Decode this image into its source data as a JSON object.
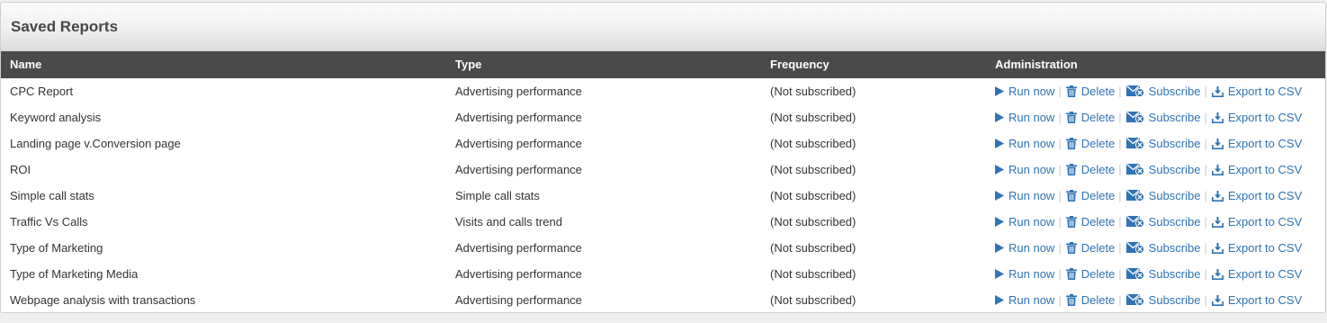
{
  "panel": {
    "title": "Saved Reports"
  },
  "table": {
    "columns": [
      "Name",
      "Type",
      "Frequency",
      "Administration"
    ],
    "rows": [
      {
        "name": "CPC Report",
        "type": "Advertising performance",
        "frequency": "(Not subscribed)"
      },
      {
        "name": "Keyword analysis",
        "type": "Advertising performance",
        "frequency": "(Not subscribed)"
      },
      {
        "name": "Landing page v.Conversion page",
        "type": "Advertising performance",
        "frequency": "(Not subscribed)"
      },
      {
        "name": "ROI",
        "type": "Advertising performance",
        "frequency": "(Not subscribed)"
      },
      {
        "name": "Simple call stats",
        "type": "Simple call stats",
        "frequency": "(Not subscribed)"
      },
      {
        "name": "Traffic Vs Calls",
        "type": "Visits and calls trend",
        "frequency": "(Not subscribed)"
      },
      {
        "name": "Type of Marketing",
        "type": "Advertising performance",
        "frequency": "(Not subscribed)"
      },
      {
        "name": "Type of Marketing Media",
        "type": "Advertising performance",
        "frequency": "(Not subscribed)"
      },
      {
        "name": "Webpage analysis with transactions",
        "type": "Advertising performance",
        "frequency": "(Not subscribed)"
      }
    ]
  },
  "actions": {
    "run_label": "Run now",
    "delete_label": "Delete",
    "subscribe_label": "Subscribe",
    "export_label": "Export to CSV",
    "separator": "|",
    "icons": {
      "run": "play-icon",
      "delete": "trash-icon",
      "subscribe": "envelope-icon",
      "export": "download-icon"
    }
  },
  "colors": {
    "link": "#2f73b6",
    "header_bg": "#4a4a4a",
    "title": "#474747"
  }
}
